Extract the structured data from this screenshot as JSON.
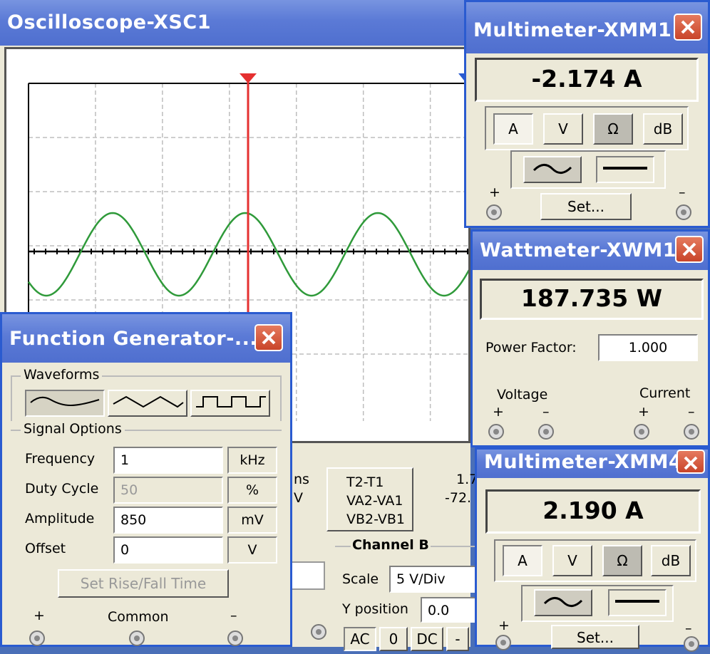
{
  "oscilloscope": {
    "title": "Oscilloscope-XSC1",
    "lower": {
      "cut_label_1": "ns",
      "cut_label_2": "V",
      "t2t1": "T2-T1",
      "va": "VA2-VA1",
      "vb": "VB2-VB1",
      "val1": "1.7",
      "val2": "-72.",
      "channel_b": "Channel B",
      "scale_label": "Scale",
      "scale_value": "5 V/Div",
      "ypos_label": "Y position",
      "ypos_value": "0.0",
      "ac": "AC",
      "zero": "0",
      "dc": "DC",
      "minus": "-"
    },
    "colors": {
      "trace": "#2f9a3a",
      "cursor": "#e53030",
      "grid": "#bdbdbd"
    }
  },
  "function_generator": {
    "title": "Function Generator-...",
    "waveforms_label": "Waveforms",
    "waveforms": [
      "sine-wave-icon",
      "triangle-wave-icon",
      "square-wave-icon"
    ],
    "signal_options_label": "Signal Options",
    "rows": [
      {
        "label": "Frequency",
        "value": "1",
        "unit": "kHz"
      },
      {
        "label": "Duty Cycle",
        "value": "50",
        "unit": "%"
      },
      {
        "label": "Amplitude",
        "value": "850",
        "unit": "mV"
      },
      {
        "label": "Offset",
        "value": "0",
        "unit": "V"
      }
    ],
    "set_rise_fall": "Set Rise/Fall Time",
    "plus": "+",
    "common": "Common",
    "minus": "–"
  },
  "multimeter1": {
    "title": "Multimeter-XMM1",
    "reading": "-2.174  A",
    "modes": [
      "A",
      "V",
      "Ω",
      "dB"
    ],
    "set": "Set...",
    "plus": "+",
    "minus": "–"
  },
  "wattmeter": {
    "title": "Wattmeter-XWM1",
    "reading": "187.735 W",
    "pf_label": "Power Factor:",
    "pf_value": "1.000",
    "voltage": "Voltage",
    "current": "Current",
    "plus": "+",
    "minus": "–"
  },
  "multimeter4": {
    "title": "Multimeter-XMM4",
    "reading": "2.190  A",
    "modes": [
      "A",
      "V",
      "Ω",
      "dB"
    ],
    "set": "Set...",
    "plus": "+",
    "minus": "–"
  }
}
